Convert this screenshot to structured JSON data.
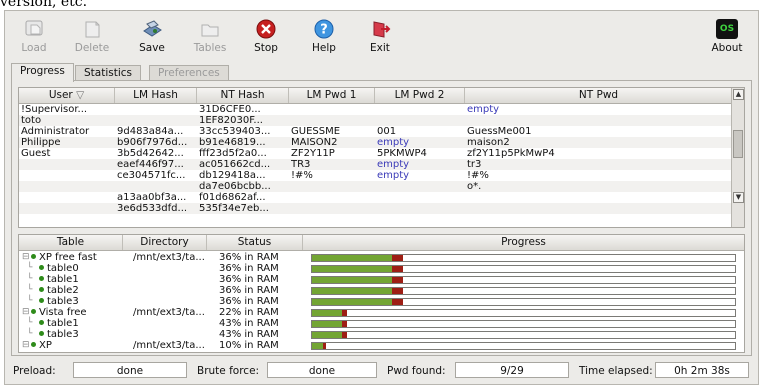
{
  "caption": "version, etc.",
  "toolbar": [
    {
      "label": "Load",
      "icon": "load-icon",
      "enabled": false
    },
    {
      "label": "Delete",
      "icon": "delete-icon",
      "enabled": false
    },
    {
      "label": "Save",
      "icon": "save-icon",
      "enabled": true
    },
    {
      "label": "Tables",
      "icon": "tables-icon",
      "enabled": false
    },
    {
      "label": "Stop",
      "icon": "stop-icon",
      "enabled": true
    },
    {
      "label": "Help",
      "icon": "help-icon",
      "enabled": true
    },
    {
      "label": "Exit",
      "icon": "exit-icon",
      "enabled": true
    },
    {
      "label": "About",
      "icon": "os-logo-icon",
      "enabled": true,
      "badge": "OS"
    }
  ],
  "tabs": [
    "Progress",
    "Statistics",
    "Preferences"
  ],
  "hash_table": {
    "columns": [
      "User",
      "LM Hash",
      "NT Hash",
      "LM Pwd 1",
      "LM Pwd 2",
      "NT Pwd"
    ],
    "rows": [
      [
        "!Supervisor...",
        "",
        "31D6CFE0...",
        "",
        "",
        "empty"
      ],
      [
        "toto",
        "",
        "1EF82030F...",
        "",
        "",
        ""
      ],
      [
        "Administrator",
        "9d483a84a...",
        "33cc539403...",
        "GUESSME",
        "001",
        "GuessMe001"
      ],
      [
        "Philippe",
        "b906f7976d...",
        "b91e46819...",
        "MAISON2",
        "empty",
        "maison2"
      ],
      [
        "Guest",
        "3b5d42642...",
        "fff23d5f2a0...",
        "ZF2Y11P",
        "5PKMWP4",
        "zf2Y11p5PkMwP4"
      ],
      [
        "",
        "eaef446f97...",
        "ac051662cd...",
        "TR3",
        "empty",
        "tr3"
      ],
      [
        "",
        "ce304571fc...",
        "db129418a...",
        "!#%",
        "empty",
        "!#%"
      ],
      [
        "",
        "",
        "da7e06bcbb...",
        "",
        "",
        "o*."
      ],
      [
        "",
        "a13aa0bf3a...",
        "f01d6862af...",
        "",
        "",
        ""
      ],
      [
        "",
        "3e6d533dfd...",
        "535f34e7eb...",
        "",
        "",
        ""
      ]
    ]
  },
  "tables_panel": {
    "columns": [
      "Table",
      "Directory",
      "Status",
      "Progress"
    ],
    "rows": [
      {
        "name": "XP free fast",
        "dir": "/mnt/ext3/ta...",
        "status": "36% in RAM",
        "level": 0,
        "progress": 0.19,
        "red": 0.025
      },
      {
        "name": "table0",
        "dir": "",
        "status": "36% in RAM",
        "level": 1,
        "progress": 0.19,
        "red": 0.025
      },
      {
        "name": "table1",
        "dir": "",
        "status": "36% in RAM",
        "level": 1,
        "progress": 0.19,
        "red": 0.025
      },
      {
        "name": "table2",
        "dir": "",
        "status": "36% in RAM",
        "level": 1,
        "progress": 0.19,
        "red": 0.025
      },
      {
        "name": "table3",
        "dir": "",
        "status": "36% in RAM",
        "level": 1,
        "progress": 0.19,
        "red": 0.025
      },
      {
        "name": "Vista free",
        "dir": "/mnt/ext3/ta...",
        "status": "22% in RAM",
        "level": 0,
        "progress": 0.07,
        "red": 0.012
      },
      {
        "name": "table1",
        "dir": "",
        "status": "43% in RAM",
        "level": 1,
        "progress": 0.07,
        "red": 0.012
      },
      {
        "name": "table3",
        "dir": "",
        "status": "43% in RAM",
        "level": 1,
        "progress": 0.07,
        "red": 0.012
      },
      {
        "name": "XP",
        "dir": "/mnt/ext3/ta...",
        "status": "10% in RAM",
        "level": 0,
        "progress": 0.025,
        "red": 0.006
      }
    ]
  },
  "status": {
    "preload_label": "Preload:",
    "preload": "done",
    "brute_label": "Brute force:",
    "brute": "done",
    "found_label": "Pwd found:",
    "found": "9/29",
    "elapsed_label": "Time elapsed:",
    "elapsed": "0h 2m 38s"
  }
}
